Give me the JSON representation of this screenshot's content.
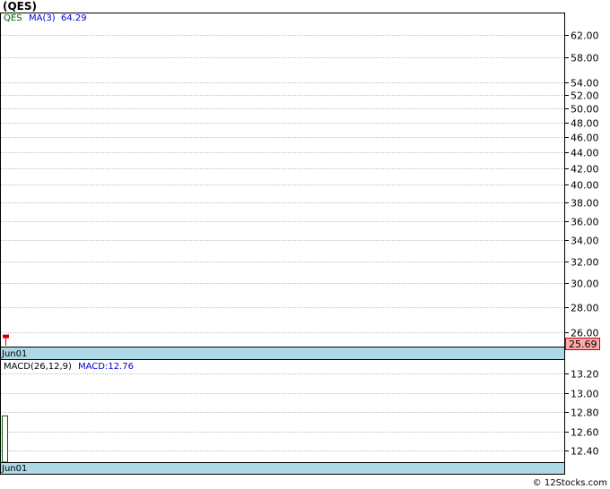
{
  "header": {
    "symbol_title": "(QES)"
  },
  "footer": {
    "copyright": "© 12Stocks.com"
  },
  "chart_data": [
    {
      "type": "line",
      "panel": "price",
      "legend": {
        "symbol": "QES",
        "ma_label": "MA(3)",
        "ma_value": "64.29"
      },
      "y_ticks": [
        "62.00",
        "58.00",
        "54.00",
        "52.00",
        "50.00",
        "48.00",
        "46.00",
        "44.00",
        "42.00",
        "40.00",
        "38.00",
        "36.00",
        "34.00",
        "32.00",
        "30.00",
        "28.00",
        "26.00"
      ],
      "y_scale": "log",
      "ylim": [
        25.0,
        66.0
      ],
      "x_label": "Jun01",
      "last_price": "25.69",
      "last_price_value": 25.69,
      "colors": {
        "price_bar": "#cc0000",
        "last_price_bg": "#ffaaaa",
        "date_strip": "#add8e6",
        "grid": "#c0c0c0",
        "symbol": "#006600",
        "ma": "#0000cc"
      },
      "grid": true
    },
    {
      "type": "bar",
      "panel": "macd",
      "legend": {
        "name": "MACD(26,12,9)",
        "value_label": "MACD:12.76"
      },
      "y_ticks": [
        "13.20",
        "13.00",
        "12.80",
        "12.60",
        "12.40"
      ],
      "ylim": [
        12.28,
        13.34
      ],
      "x_label": "Jun01",
      "values": [
        12.76
      ],
      "colors": {
        "bar": "#006600",
        "date_strip": "#add8e6",
        "grid": "#c0c0c0",
        "ma": "#0000cc"
      },
      "grid": true
    }
  ]
}
